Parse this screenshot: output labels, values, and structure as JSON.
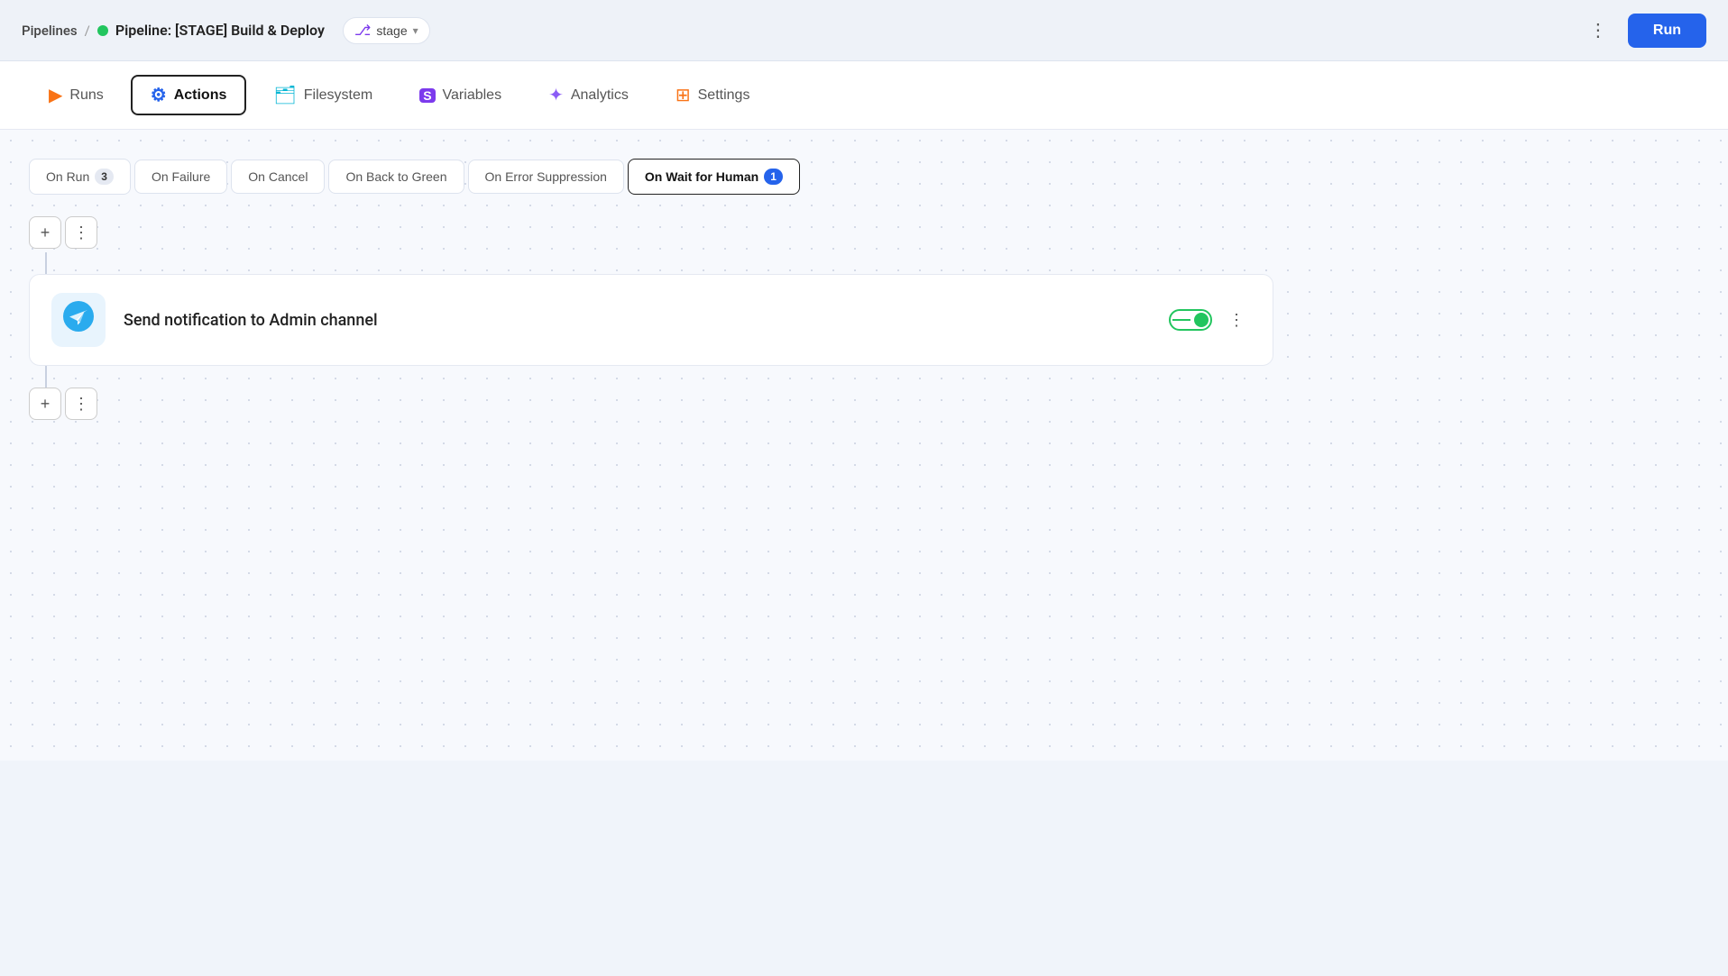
{
  "header": {
    "breadcrumb_pipelines": "Pipelines",
    "breadcrumb_sep": "/",
    "pipeline_title": "Pipeline: [STAGE] Build & Deploy",
    "stage_label": "stage",
    "more_btn_label": "⋮",
    "run_btn_label": "Run"
  },
  "tabs": {
    "items": [
      {
        "id": "runs",
        "label": "Runs",
        "icon": "▶"
      },
      {
        "id": "actions",
        "label": "Actions",
        "icon": "⚙",
        "active": true
      },
      {
        "id": "filesystem",
        "label": "Filesystem",
        "icon": "📂"
      },
      {
        "id": "variables",
        "label": "Variables",
        "icon": "S"
      },
      {
        "id": "analytics",
        "label": "Analytics",
        "icon": "✦"
      },
      {
        "id": "settings",
        "label": "Settings",
        "icon": "🟧"
      }
    ]
  },
  "sub_tabs": {
    "items": [
      {
        "id": "on_run",
        "label": "On Run",
        "badge": "3"
      },
      {
        "id": "on_failure",
        "label": "On Failure",
        "badge": ""
      },
      {
        "id": "on_cancel",
        "label": "On Cancel",
        "badge": ""
      },
      {
        "id": "on_back_to_green",
        "label": "On Back to Green",
        "badge": ""
      },
      {
        "id": "on_error_suppression",
        "label": "On Error Suppression",
        "badge": ""
      },
      {
        "id": "on_wait_for_human",
        "label": "On Wait for Human",
        "badge": "1",
        "active": true
      }
    ]
  },
  "actions": {
    "add_btn_label": "+",
    "more_btn_label": "⋮",
    "card": {
      "icon": "✈",
      "label": "Send notification to Admin channel",
      "toggle_enabled": true
    }
  }
}
